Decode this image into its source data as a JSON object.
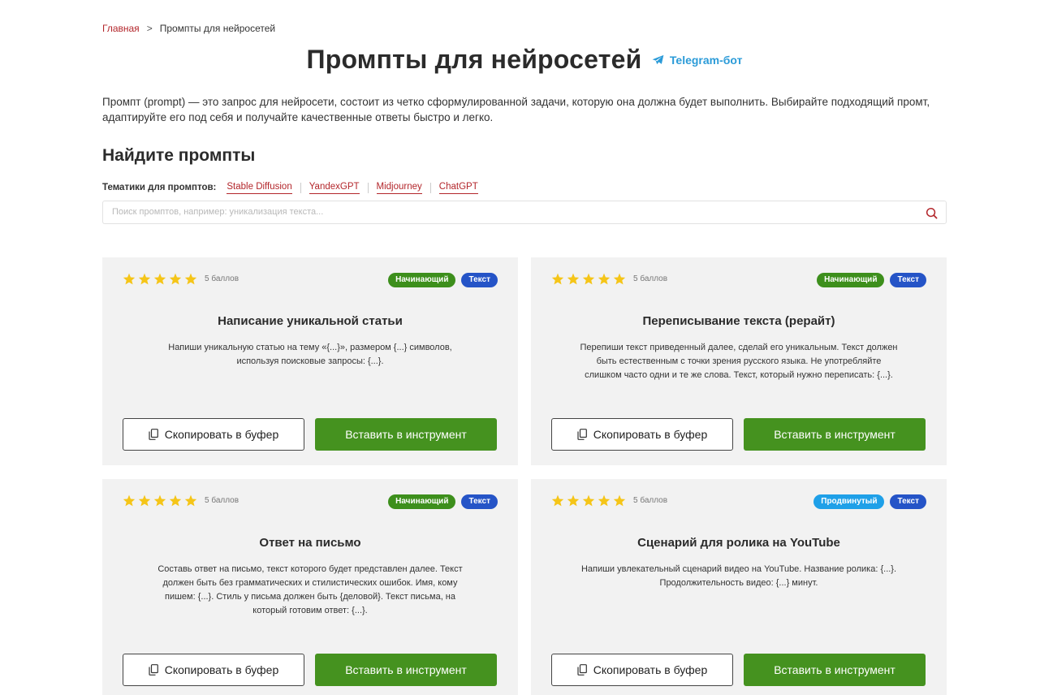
{
  "breadcrumb": {
    "home": "Главная",
    "separator": ">",
    "current": "Промпты для нейросетей"
  },
  "page": {
    "title": "Промпты для нейросетей",
    "telegram_label": "Telegram-бот",
    "intro": "Промпт (prompt) — это запрос для нейросети, состоит из четко сформулированной задачи, которую она должна будет выполнить. Выбирайте подходящий промт, адаптируйте его под себя и получайте качественные ответы быстро и легко.",
    "find_heading": "Найдите промпты"
  },
  "topics": {
    "label": "Тематики для промптов:",
    "items": [
      "Stable Diffusion",
      "YandexGPT",
      "Midjourney",
      "ChatGPT"
    ]
  },
  "search": {
    "placeholder": "Поиск промптов, например: уникализация текста..."
  },
  "cards": [
    {
      "score": "5 баллов",
      "rating": 5,
      "level": "Начинающий",
      "level_color": "#3d8f1c",
      "type": "Текст",
      "type_color": "#2554c7",
      "title": "Написание уникальной статьи",
      "description": "Напиши уникальную статью на тему «{...}», размером {...} символов, используя поисковые запросы: {...}.",
      "copy_label": "Скопировать в буфер",
      "insert_label": "Вставить в инструмент"
    },
    {
      "score": "5 баллов",
      "rating": 5,
      "level": "Начинающий",
      "level_color": "#3d8f1c",
      "type": "Текст",
      "type_color": "#2554c7",
      "title": "Переписывание текста (рерайт)",
      "description": "Перепиши текст приведенный далее, сделай его уникальным. Текст должен быть естественным с точки зрения русского языка. Не употребляйте слишком часто одни и те же слова. Текст, который нужно переписать: {...}.",
      "copy_label": "Скопировать в буфер",
      "insert_label": "Вставить в инструмент"
    },
    {
      "score": "5 баллов",
      "rating": 5,
      "level": "Начинающий",
      "level_color": "#3d8f1c",
      "type": "Текст",
      "type_color": "#2554c7",
      "title": "Ответ на письмо",
      "description": "Составь ответ на письмо, текст которого будет представлен далее. Текст должен быть без грамматических и стилистических ошибок. Имя, кому пишем: {...}. Стиль у письма должен быть {деловой}. Текст письма, на который готовим ответ: {...}.",
      "copy_label": "Скопировать в буфер",
      "insert_label": "Вставить в инструмент"
    },
    {
      "score": "5 баллов",
      "rating": 5,
      "level": "Продвинутый",
      "level_color": "#1fa0e8",
      "type": "Текст",
      "type_color": "#2554c7",
      "title": "Сценарий для ролика на YouTube",
      "description": "Напиши увлекательный сценарий видео на YouTube. Название ролика: {...}. Продолжительность видео: {...} минут.",
      "copy_label": "Скопировать в буфер",
      "insert_label": "Вставить в инструмент"
    }
  ],
  "colors": {
    "accent_red": "#b3262b",
    "button_green": "#45921f",
    "star_yellow": "#f5c518",
    "telegram_blue": "#2b9bd8"
  }
}
